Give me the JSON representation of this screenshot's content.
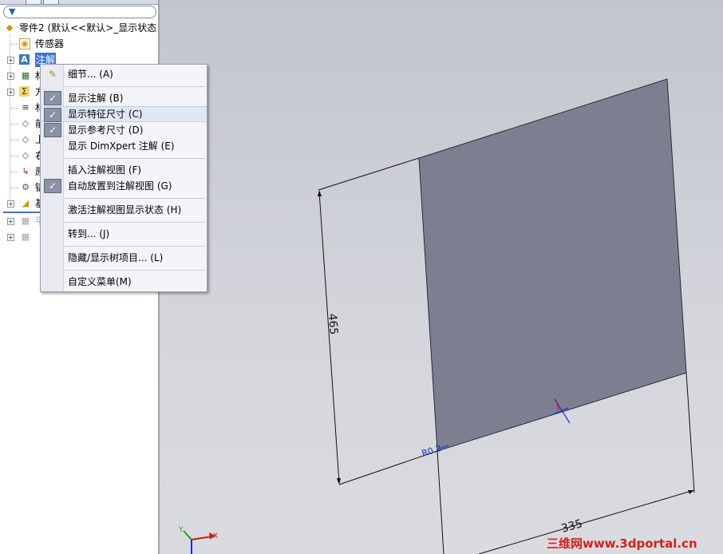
{
  "tree": {
    "filter_icon": "filter-icon",
    "root_label": "零件2  (默认<<默认>_显示状态",
    "items": [
      {
        "label": "传感器",
        "icon": "sensor-icon"
      },
      {
        "label": "注解",
        "icon": "annotation-icon"
      },
      {
        "label": "材",
        "icon": "table-icon"
      },
      {
        "label": "方",
        "icon": "equation-icon"
      },
      {
        "label": "材",
        "icon": "material-icon"
      },
      {
        "label": "前",
        "icon": "plane-icon"
      },
      {
        "label": "上",
        "icon": "plane-icon"
      },
      {
        "label": "右",
        "icon": "plane-icon"
      },
      {
        "label": "原",
        "icon": "origin-icon"
      },
      {
        "label": "钣",
        "icon": "sheetmetal-icon"
      },
      {
        "label": "基",
        "icon": "base-flange-icon"
      },
      {
        "label": "平",
        "icon": "flat-pattern-icon"
      }
    ]
  },
  "context_menu": {
    "items": [
      {
        "label": "细节... (A)",
        "checked": false,
        "icon": "properties-icon"
      },
      {
        "label": "显示注解 (B)",
        "checked": true
      },
      {
        "label": "显示特征尺寸 (C)",
        "checked": true,
        "highlighted": true
      },
      {
        "label": "显示参考尺寸 (D)",
        "checked": true
      },
      {
        "label": "显示 DimXpert 注解 (E)",
        "checked": false
      },
      {
        "label": "插入注解视图 (F)",
        "checked": false
      },
      {
        "label": "自动放置到注解视图 (G)",
        "checked": true
      },
      {
        "label": "激活注解视图显示状态 (H)",
        "checked": false
      },
      {
        "label": "转到... (J)",
        "checked": false
      },
      {
        "label": "隐藏/显示树项目... (L)",
        "checked": false
      },
      {
        "label": "自定义菜单(M)",
        "checked": false
      }
    ]
  },
  "viewport": {
    "dim_vertical": "465",
    "dim_horizontal": "335",
    "dim_radius": "R0.2",
    "part_color": "#7c7f90",
    "axis_x": "X",
    "axis_y": "Y"
  },
  "watermark": "三维网www.3dportal.cn"
}
